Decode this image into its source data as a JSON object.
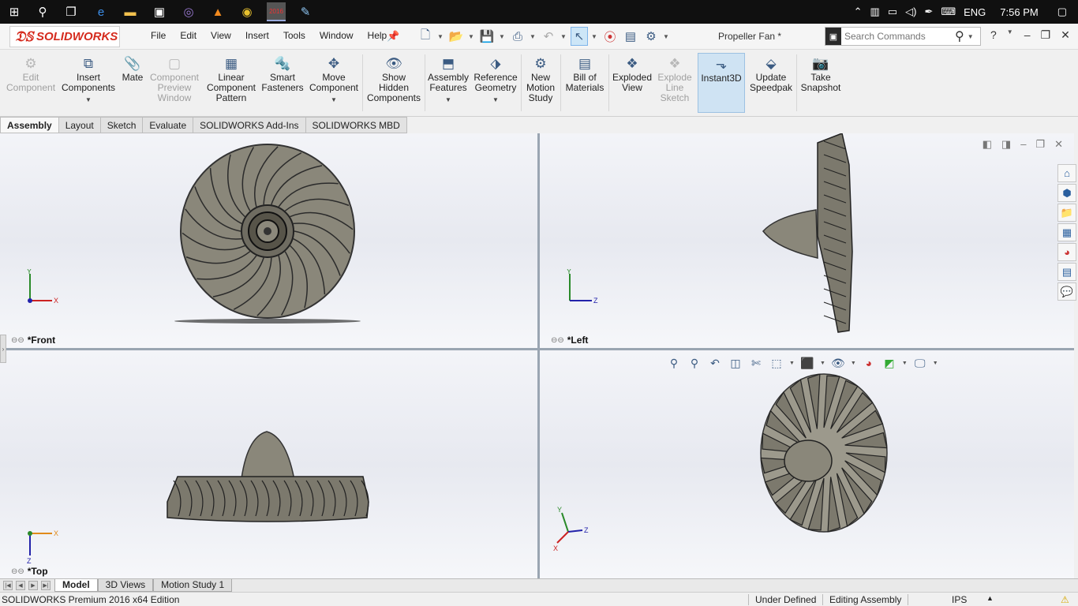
{
  "taskbar": {
    "icons": [
      "windows-icon",
      "search-icon",
      "task-view-icon",
      "edge-icon",
      "file-explorer-icon",
      "store-icon",
      "tor-browser-icon",
      "vlc-icon",
      "chrome-icon",
      "solidworks-2016-icon",
      "paint-icon"
    ],
    "language": "ENG",
    "time": "7:56 PM"
  },
  "app": {
    "logo": "SOLIDWORKS",
    "menu": [
      "File",
      "Edit",
      "View",
      "Insert",
      "Tools",
      "Window",
      "Help"
    ],
    "document_title": "Propeller Fan *",
    "search_placeholder": "Search Commands"
  },
  "ribbon": {
    "edit_component": "Edit\nComponent",
    "insert_components": "Insert\nComponents",
    "mate": "Mate",
    "component_preview": "Component\nPreview\nWindow",
    "linear_pattern": "Linear\nComponent\nPattern",
    "smart_fasteners": "Smart\nFasteners",
    "move_component": "Move\nComponent",
    "show_hidden": "Show\nHidden\nComponents",
    "assembly_features": "Assembly\nFeatures",
    "reference_geometry": "Reference\nGeometry",
    "new_motion_study": "New\nMotion\nStudy",
    "bill_of_materials": "Bill of\nMaterials",
    "exploded_view": "Exploded\nView",
    "explode_line": "Explode\nLine\nSketch",
    "instant3d": "Instant3D",
    "update_speedpak": "Update\nSpeedpak",
    "take_snapshot": "Take\nSnapshot"
  },
  "command_tabs": [
    "Assembly",
    "Layout",
    "Sketch",
    "Evaluate",
    "SOLIDWORKS Add-Ins",
    "SOLIDWORKS MBD"
  ],
  "viewports": {
    "front": "*Front",
    "left": "*Left",
    "top": "*Top"
  },
  "triad": {
    "x": "X",
    "y": "Y",
    "z": "Z"
  },
  "model_tabs": [
    "Model",
    "3D Views",
    "Motion Study 1"
  ],
  "status": {
    "edition": "SOLIDWORKS Premium 2016 x64 Edition",
    "defined": "Under Defined",
    "mode": "Editing Assembly",
    "units": "IPS"
  },
  "colors": {
    "accent": "#d52b1e",
    "viewport_divider": "#9aa5b2",
    "part": "#7a776c"
  }
}
